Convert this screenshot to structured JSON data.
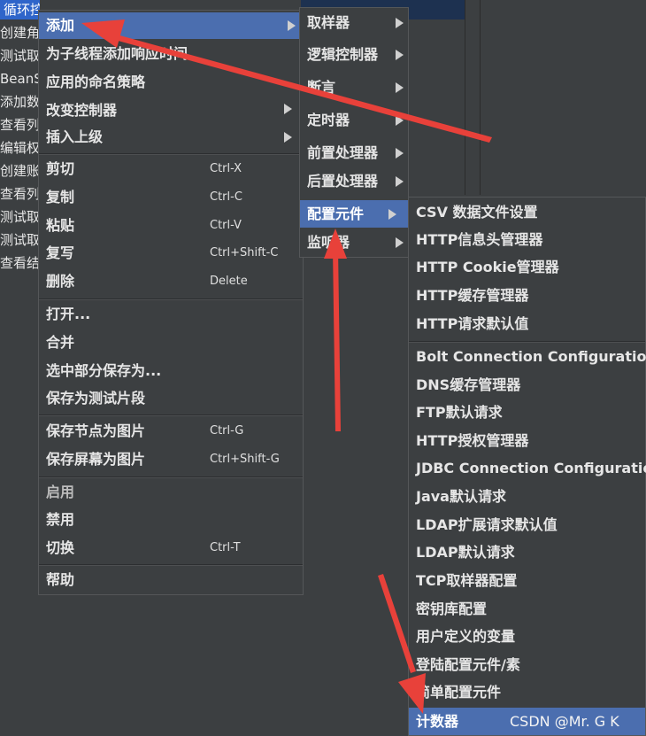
{
  "tree": {
    "items": [
      "循环控制器",
      "创建角色",
      "测试取",
      "BeanS",
      "添加数据",
      "查看列",
      "编辑权",
      "创建账",
      "查看列",
      "测试取",
      "测试取样",
      "查看结果"
    ]
  },
  "context_menu": {
    "items": [
      {
        "label": "添加",
        "shortcut": "",
        "submenu": true
      },
      {
        "label": "为子线程添加响应时间",
        "shortcut": "",
        "submenu": false
      },
      {
        "label": "应用的命名策略",
        "shortcut": "",
        "submenu": false
      },
      {
        "label": "改变控制器",
        "shortcut": "",
        "submenu": true
      },
      {
        "label": "插入上级",
        "shortcut": "",
        "submenu": true
      },
      {
        "label": "剪切",
        "shortcut": "Ctrl-X"
      },
      {
        "label": "复制",
        "shortcut": "Ctrl-C"
      },
      {
        "label": "粘贴",
        "shortcut": "Ctrl-V"
      },
      {
        "label": "复写",
        "shortcut": "Ctrl+Shift-C"
      },
      {
        "label": "删除",
        "shortcut": "Delete"
      },
      {
        "label": "打开...",
        "shortcut": ""
      },
      {
        "label": "合并",
        "shortcut": ""
      },
      {
        "label": "选中部分保存为...",
        "shortcut": ""
      },
      {
        "label": "保存为测试片段",
        "shortcut": ""
      },
      {
        "label": "保存节点为图片",
        "shortcut": "Ctrl-G"
      },
      {
        "label": "保存屏幕为图片",
        "shortcut": "Ctrl+Shift-G"
      },
      {
        "label": "启用",
        "shortcut": ""
      },
      {
        "label": "禁用",
        "shortcut": ""
      },
      {
        "label": "切换",
        "shortcut": "Ctrl-T"
      },
      {
        "label": "帮助",
        "shortcut": ""
      }
    ]
  },
  "add_submenu": {
    "items": [
      "取样器",
      "逻辑控制器",
      "断言",
      "定时器",
      "前置处理器",
      "后置处理器",
      "配置元件",
      "监听器"
    ]
  },
  "config_submenu": {
    "items": [
      "CSV 数据文件设置",
      "HTTP信息头管理器",
      "HTTP Cookie管理器",
      "HTTP缓存管理器",
      "HTTP请求默认值",
      "Bolt Connection Configuration",
      "DNS缓存管理器",
      "FTP默认请求",
      "HTTP授权管理器",
      "JDBC Connection Configuration",
      "Java默认请求",
      "LDAP扩展请求默认值",
      "LDAP默认请求",
      "TCP取样器配置",
      "密钥库配置",
      "用户定义的变量",
      "登陆配置元件/素",
      "简单配置元件",
      "计数器"
    ],
    "watermark": "CSDN @Mr. G K"
  },
  "colors": {
    "background": "#3c3f41",
    "highlight": "#4b6eaf",
    "annotation_arrow": "#e8413a"
  }
}
